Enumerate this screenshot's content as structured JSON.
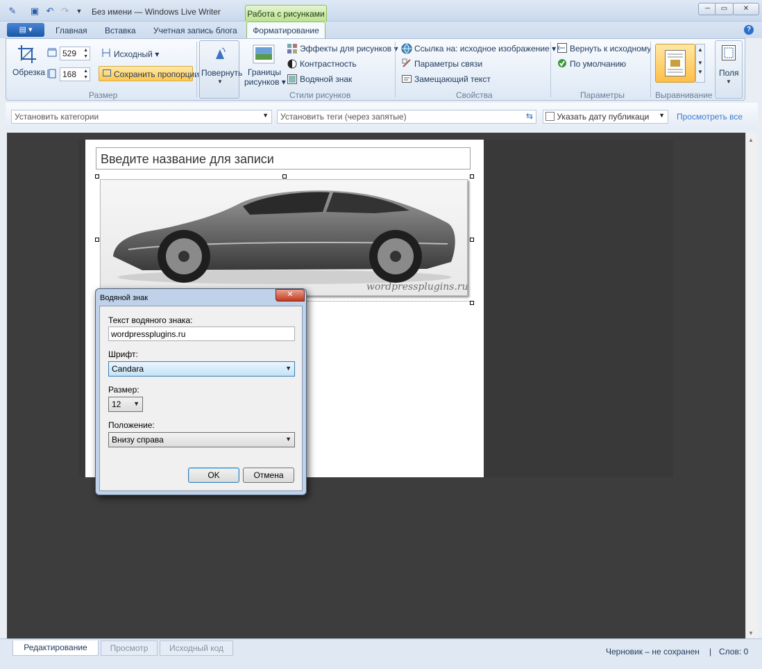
{
  "window": {
    "title": "Без имени — Windows Live Writer",
    "context_tab": "Работа с рисунками",
    "controls": [
      "─",
      "▭",
      "✕"
    ]
  },
  "tabs": [
    "Главная",
    "Вставка",
    "Учетная запись блога",
    "Форматирование"
  ],
  "ribbon": {
    "size": {
      "crop_label": "Обрезка",
      "width_value": "529",
      "height_value": "168",
      "original_dropdown": "Исходный",
      "keep_proportions": "Сохранить пропорции",
      "group_label": "Размер"
    },
    "rotate_label": "Повернуть",
    "styles": {
      "borders_label_line1": "Границы",
      "borders_label_line2": "рисунков",
      "effects": "Эффекты для рисунков",
      "contrast": "Контрастность",
      "watermark": "Водяной знак",
      "group_label": "Стили рисунков"
    },
    "properties": {
      "link_to": "Ссылка на: исходное изображение",
      "link_params": "Параметры связи",
      "alt_text": "Замещающий текст",
      "group_label": "Свойства"
    },
    "params": {
      "revert": "Вернуть к исходному",
      "default": "По умолчанию",
      "group_label": "Параметры"
    },
    "align_group_label": "Выравнивание",
    "fields_label": "Поля"
  },
  "toolbar2": {
    "categories_placeholder": "Установить категории",
    "tags_placeholder": "Установить теги (через запятые)",
    "publish_date_label": "Указать дату публикаци",
    "view_all_link": "Просмотреть все"
  },
  "editor": {
    "post_title_placeholder": "Введите название для записи",
    "image_watermark_text": "wordpressplugins.ru"
  },
  "dialog": {
    "title": "Водяной знак",
    "text_label": "Текст водяного знака:",
    "text_value": "wordpressplugins.ru",
    "font_label": "Шрифт:",
    "font_value": "Candara",
    "size_label": "Размер:",
    "size_value": "12",
    "position_label": "Положение:",
    "position_value": "Внизу справа",
    "ok": "OK",
    "cancel": "Отмена"
  },
  "status": {
    "view_tabs": [
      "Редактирование",
      "Просмотр",
      "Исходный код"
    ],
    "draft_status": "Черновик – не сохранен",
    "separator": "|",
    "word_count": "Слов: 0"
  },
  "colors": {
    "accent": "#1a56a8",
    "context_green": "#b9e08e",
    "highlight": "#ffc74e",
    "editor_bg": "#3d3d3d"
  }
}
